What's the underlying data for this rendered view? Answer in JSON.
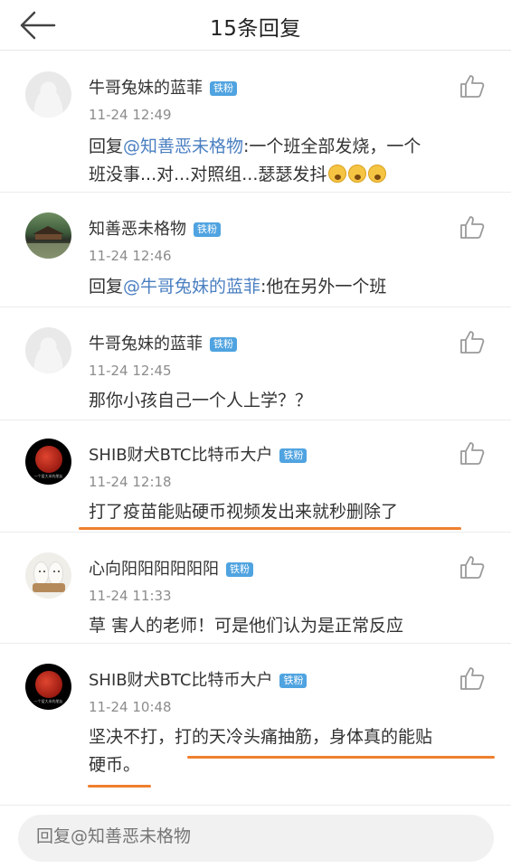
{
  "header": {
    "title": "15条回复"
  },
  "comments": [
    {
      "name": "牛哥兔妹的蓝菲",
      "badge": "铁粉",
      "time": "11-24 12:49",
      "text_prefix": "回复",
      "mention": "@知善恶未格物",
      "text_line1_rest": ":一个班全部发烧，一个",
      "text_line2": "班没事...对...对照组...瑟瑟发抖",
      "emoji": "astonished-face-emoji"
    },
    {
      "name": "知善恶未格物",
      "badge": "铁粉",
      "time": "11-24 12:46",
      "text_prefix": "回复",
      "mention": "@牛哥兔妹的蓝菲",
      "text_rest": ":他在另外一个班"
    },
    {
      "name": "牛哥兔妹的蓝菲",
      "badge": "铁粉",
      "time": "11-24 12:45",
      "text": "那你小孩自己一个人上学？？"
    },
    {
      "name": "SHIB财犬BTC比特币大户",
      "badge": "铁粉",
      "time": "11-24 12:18",
      "text": "打了疫苗能贴硬币视频发出来就秒删除了",
      "avatar_caption": "一个爱大米的朋友"
    },
    {
      "name": "心向阳阳阳阳阳阳",
      "badge": "铁粉",
      "time": "11-24 11:33",
      "text": "草 害人的老师！可是他们认为是正常反应"
    },
    {
      "name": "SHIB财犬BTC比特币大户",
      "badge": "铁粉",
      "time": "11-24 10:48",
      "text_line1": "坚决不打，打的天冷头痛抽筋，身体真的能贴",
      "text_line2": "硬币。",
      "avatar_caption": "一个爱大米的朋友"
    }
  ],
  "reply_bar": {
    "placeholder": "回复@知善恶未格物"
  },
  "colors": {
    "mention": "#4a7fc1",
    "badge": "#4fa3e0",
    "highlight_underline": "#ef7f2e"
  }
}
